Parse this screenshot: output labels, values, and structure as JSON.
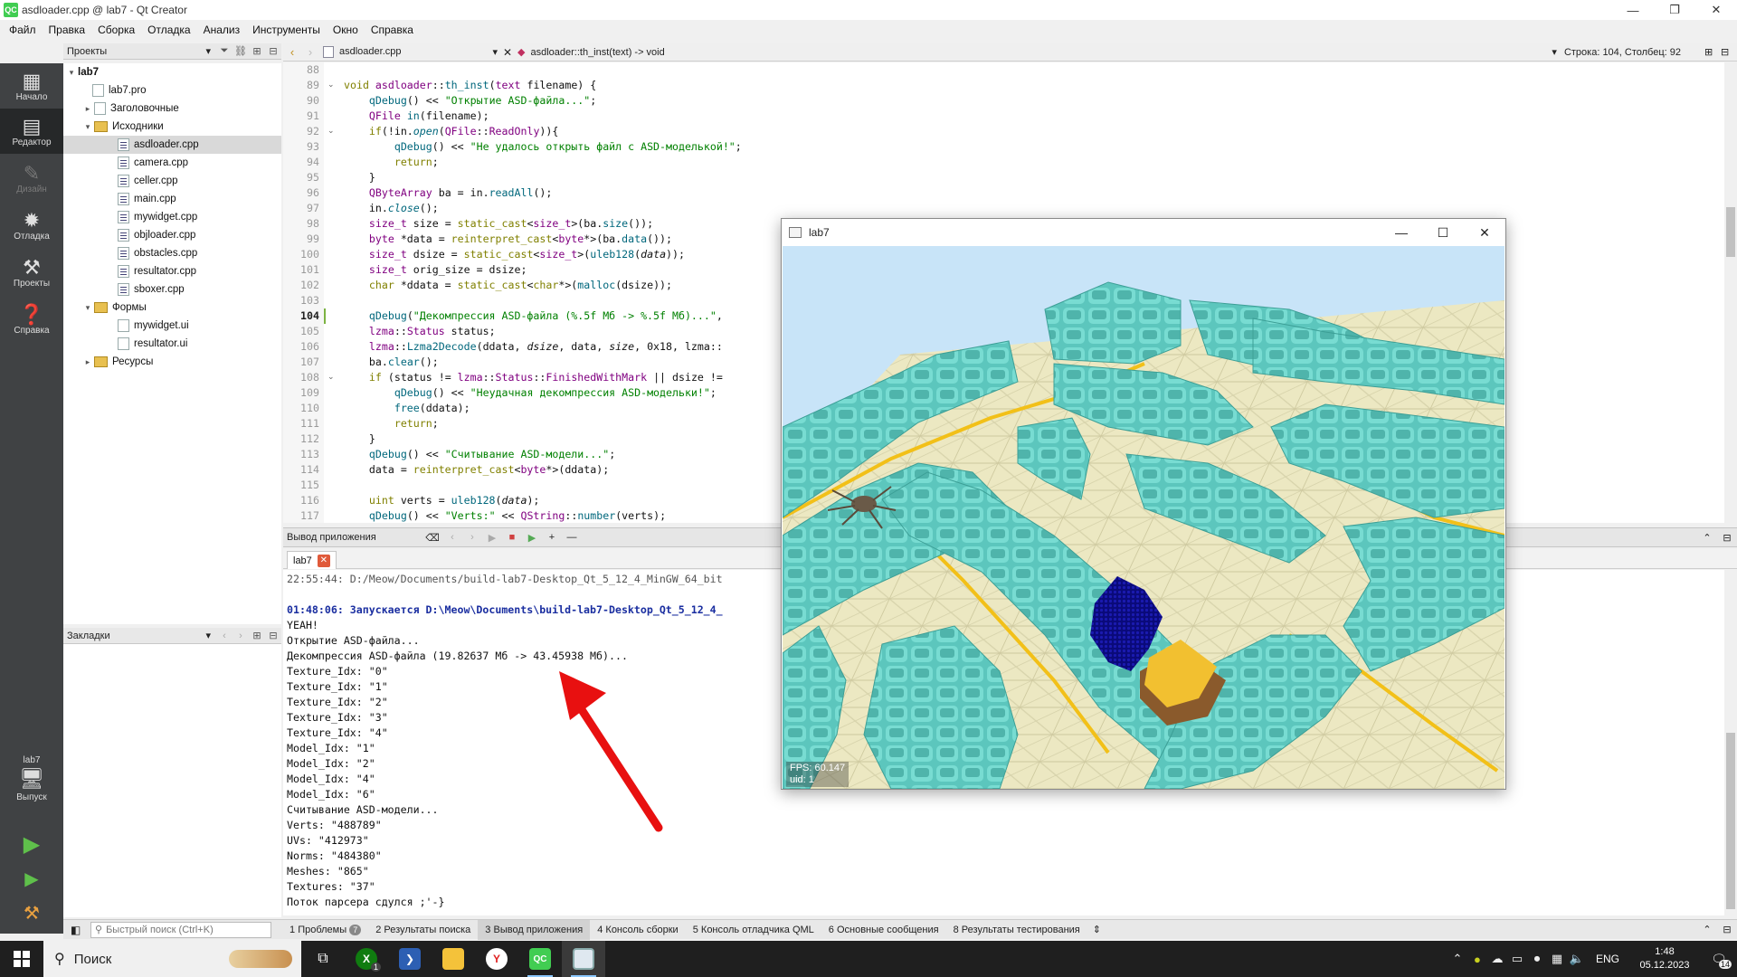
{
  "window": {
    "title": "asdloader.cpp @ lab7 - Qt Creator",
    "controls": [
      "—",
      "❐",
      "✕"
    ]
  },
  "menu": [
    "Файл",
    "Правка",
    "Сборка",
    "Отладка",
    "Анализ",
    "Инструменты",
    "Окно",
    "Справка"
  ],
  "modes": {
    "welcome": "Начало",
    "edit": "Редактор",
    "design": "Дизайн",
    "debug": "Отладка",
    "projects": "Проекты",
    "help": "Справка",
    "kit_name": "lab7",
    "kit_label": "Выпуск"
  },
  "projects_pane": {
    "title": "Проекты",
    "tree": {
      "root": "lab7",
      "pro": "lab7.pro",
      "headers": "Заголовочные",
      "sources": "Исходники",
      "source_files": [
        "asdloader.cpp",
        "camera.cpp",
        "celler.cpp",
        "main.cpp",
        "mywidget.cpp",
        "objloader.cpp",
        "obstacles.cpp",
        "resultator.cpp",
        "sboxer.cpp"
      ],
      "forms": "Формы",
      "form_files": [
        "mywidget.ui",
        "resultator.ui"
      ],
      "resources": "Ресурсы"
    }
  },
  "bookmarks_pane": {
    "title": "Закладки"
  },
  "editor": {
    "file": "asdloader.cpp",
    "function": "asdloader::th_inst(text) -> void",
    "position": "Строка: 104, Столбец: 92",
    "current_line": "104",
    "line_numbers": [
      "88",
      "89",
      "90",
      "91",
      "92",
      "93",
      "94",
      "95",
      "96",
      "97",
      "98",
      "99",
      "100",
      "101",
      "102",
      "103",
      "104",
      "105",
      "106",
      "107",
      "108",
      "109",
      "110",
      "111",
      "112",
      "113",
      "114",
      "115",
      "116",
      "117"
    ]
  },
  "output_pane": {
    "title": "Вывод приложения",
    "tab": "lab7",
    "lines": [
      "22:55:44: D:/Meow/Documents/build-lab7-Desktop_Qt_5_12_4_MinGW_64_bit",
      "",
      "01:48:06: Запускается D:\\Meow\\Documents\\build-lab7-Desktop_Qt_5_12_4_",
      "YEAH!",
      "Открытие ASD-файла...",
      "Декомпрессия ASD-файла (19.82637 Мб -> 43.45938 Мб)...",
      "Texture_Idx: \"0\"",
      "Texture_Idx: \"1\"",
      "Texture_Idx: \"2\"",
      "Texture_Idx: \"3\"",
      "Texture_Idx: \"4\"",
      "Model_Idx: \"1\"",
      "Model_Idx: \"2\"",
      "Model_Idx: \"4\"",
      "Model_Idx: \"6\"",
      "Считывание ASD-модели...",
      "Verts: \"488789\"",
      "UVs: \"412973\"",
      "Norms: \"484380\"",
      "Meshes: \"865\"",
      "Textures: \"37\"",
      "Поток парсера сдулся ;'-}"
    ]
  },
  "statusbar": {
    "search_placeholder": "Быстрый поиск (Ctrl+K)",
    "tabs": [
      {
        "num": "1",
        "label": "Проблемы",
        "badge": "7"
      },
      {
        "num": "2",
        "label": "Результаты поиска"
      },
      {
        "num": "3",
        "label": "Вывод приложения"
      },
      {
        "num": "4",
        "label": "Консоль сборки"
      },
      {
        "num": "5",
        "label": "Консоль отладчика QML"
      },
      {
        "num": "6",
        "label": "Основные сообщения"
      },
      {
        "num": "8",
        "label": "Результаты тестирования"
      }
    ]
  },
  "app_window": {
    "title": "lab7",
    "fps": "FPS: 60.147",
    "uid": "uid: 1"
  },
  "taskbar": {
    "search_label": "Поиск",
    "lang": "ENG",
    "time": "1:48",
    "date": "05.12.2023",
    "notifications": "14",
    "xbox_badge": "1"
  },
  "colors": {
    "modebar": "#404244",
    "annotation_arrow": "#e81010",
    "wall": "#5fc8c0",
    "floor": "#ece8c0",
    "sky": "#c8e4f8"
  }
}
